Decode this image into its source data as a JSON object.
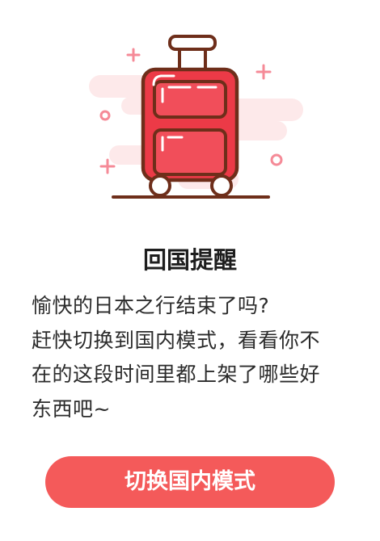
{
  "dialog": {
    "title": "回国提醒",
    "message_lines": [
      "愉快的日本之行结束了吗?",
      "赶快切换到国内模式，看看你不",
      "在的这段时间里都上架了哪些好",
      "东西吧~"
    ],
    "primary_button_label": "切换国内模式"
  },
  "illustration": {
    "icon": "suitcase-icon",
    "colors": {
      "suitcase_red": "#ec3a47",
      "outline_brown": "#6e2e1a",
      "cloud_pink": "#fde9ea",
      "sparkle_pink": "#f58a97"
    }
  },
  "theme": {
    "accent": "#f45a5a",
    "text": "#2b2b2b"
  }
}
